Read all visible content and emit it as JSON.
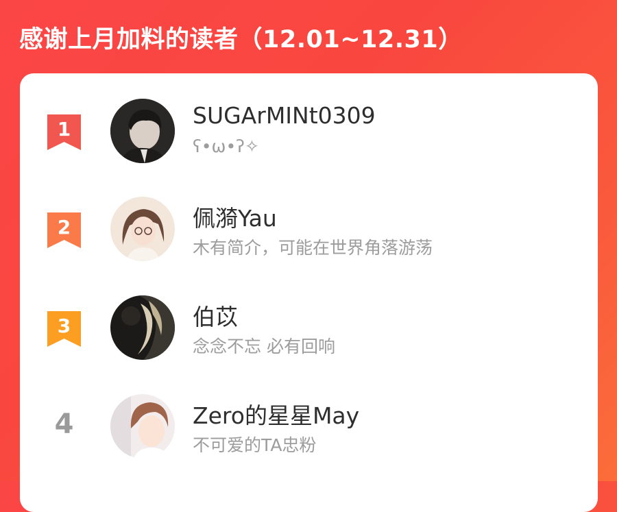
{
  "header": {
    "title": "感谢上月加料的读者（12.01~12.31）"
  },
  "colors": {
    "background": "#fb4a41",
    "rank_1": "#f2574f",
    "rank_2": "#fb7a4a",
    "rank_3": "#fb9e22",
    "rank_plain": "#9a9a9a"
  },
  "readers": [
    {
      "rank": "1",
      "name": "SUGArMINt0309",
      "bio": "ʕ•ω•ʔ✧",
      "avatar": "avatar-photo-boy"
    },
    {
      "rank": "2",
      "name": "佩漪Yau",
      "bio": "木有简介，可能在世界角落游荡",
      "avatar": "avatar-illustrated-girl"
    },
    {
      "rank": "3",
      "name": "伯苡",
      "bio": "念念不忘 必有回响",
      "avatar": "avatar-dark-silhouette"
    },
    {
      "rank": "4",
      "name": "Zero的星星May",
      "bio": "不可爱的TA忠粉",
      "avatar": "avatar-illustrated-boy"
    }
  ]
}
